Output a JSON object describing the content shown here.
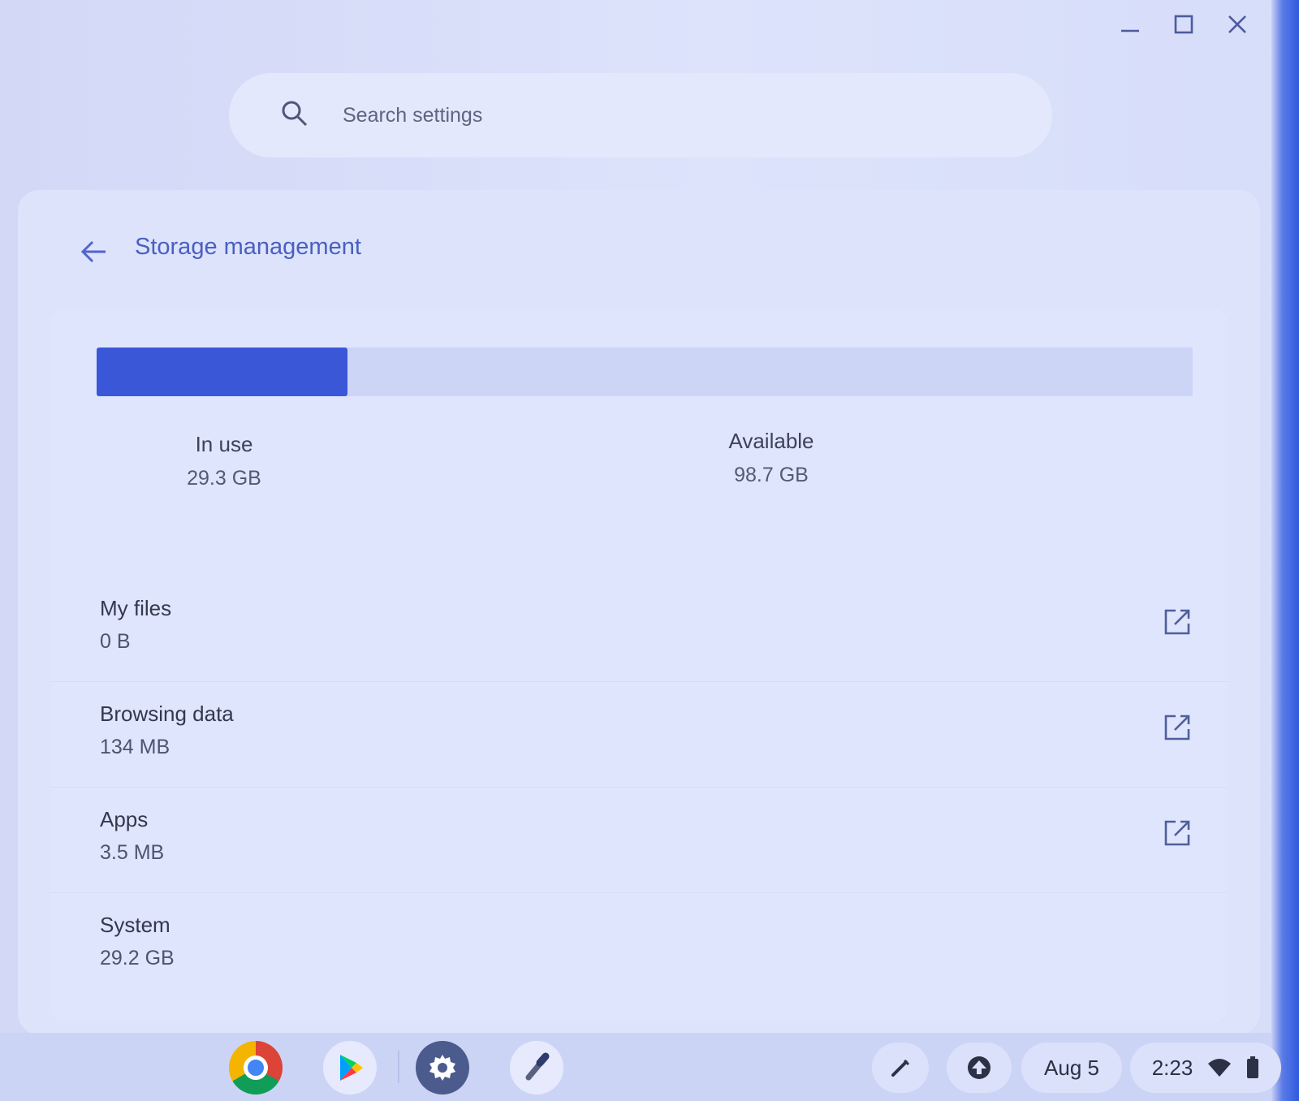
{
  "window": {
    "controls": [
      "minimize",
      "maximize",
      "close"
    ]
  },
  "search": {
    "placeholder": "Search settings"
  },
  "page": {
    "title": "Storage management"
  },
  "storage": {
    "in_use_label": "In use",
    "in_use_value": "29.3 GB",
    "available_label": "Available",
    "available_value": "98.7 GB",
    "used_fraction": 0.229,
    "bar_color": "#3a57d8"
  },
  "items": [
    {
      "name": "My files",
      "size": "0 B",
      "external": true
    },
    {
      "name": "Browsing data",
      "size": "134 MB",
      "external": true
    },
    {
      "name": "Apps",
      "size": "3.5 MB",
      "external": true
    },
    {
      "name": "System",
      "size": "29.2 GB",
      "external": false
    }
  ],
  "shelf": {
    "apps": [
      "chrome-icon",
      "play-store-icon",
      "settings-icon",
      "flashlight-icon"
    ],
    "date": "Aug 5",
    "time": "2:23"
  }
}
